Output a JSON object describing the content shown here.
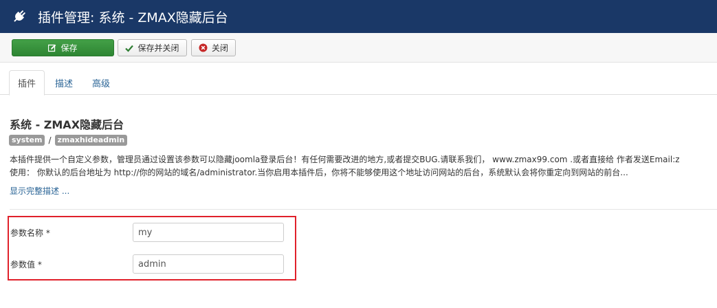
{
  "header": {
    "title": "插件管理: 系统 - ZMAX隐藏后台",
    "icon": "plug-icon",
    "background": "#1a3867"
  },
  "toolbar": {
    "save_label": "保存",
    "save_close_label": "保存并关闭",
    "close_label": "关闭",
    "save_color": "#3a9a3f"
  },
  "tabs": [
    {
      "label": "插件",
      "active": true
    },
    {
      "label": "描述",
      "active": false
    },
    {
      "label": "高级",
      "active": false
    }
  ],
  "plugin": {
    "title": "系统 - ZMAX隐藏后台",
    "badges": [
      "system",
      "zmaxhideadmin"
    ],
    "badge_separator": "/",
    "description_line1": "本插件提供一个自定义参数，管理员通过设置该参数可以隐藏joomla登录后台！有任何需要改进的地方,或者提交BUG.请联系我们， www.zmax99.com .或者直接给 作者发送Email:z",
    "description_line2": "使用： 你默认的后台地址为 http://你的网站的域名/administrator.当你启用本插件后，你将不能够使用这个地址访问网站的后台，系统默认会将你重定向到网站的前台...",
    "show_full_label": "显示完整描述 ..."
  },
  "fields": [
    {
      "label": "参数名称 *",
      "value": "my"
    },
    {
      "label": "参数值 *",
      "value": "admin"
    }
  ],
  "highlight_color": "#e0202a"
}
